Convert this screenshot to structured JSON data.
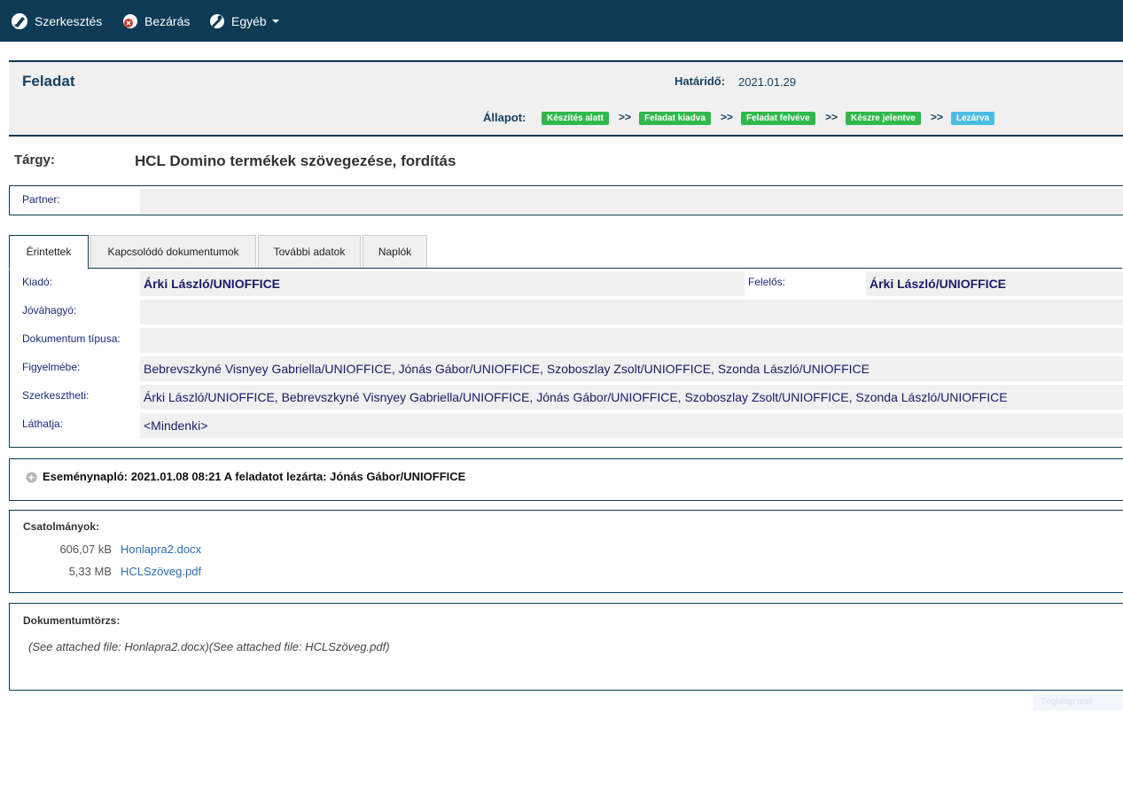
{
  "toolbar": {
    "edit_label": "Szerkesztés",
    "close_label": "Bezárás",
    "other_label": "Egyéb"
  },
  "header": {
    "title": "Feladat",
    "deadline_label": "Határidő:",
    "deadline_value": "2021.01.29",
    "status_label": "Állapot:",
    "arrow": ">>",
    "statuses": [
      {
        "label": "Készítés alatt",
        "color": "#2fb84c"
      },
      {
        "label": "Feladat kiadva",
        "color": "#2fb84c"
      },
      {
        "label": "Feladat felvéve",
        "color": "#2fb84c"
      },
      {
        "label": "Készre jelentve",
        "color": "#2fb84c"
      },
      {
        "label": "Lezárva",
        "color": "#4bbde0"
      }
    ]
  },
  "subject": {
    "label": "Tárgy:",
    "value": "HCL Domino termékek szövegezése, fordítás"
  },
  "partner": {
    "label": "Partner:",
    "value": ""
  },
  "tabs": [
    {
      "label": "Érintettek"
    },
    {
      "label": "Kapcsolódó dokumentumok"
    },
    {
      "label": "További adatok"
    },
    {
      "label": "Naplók"
    }
  ],
  "fields": {
    "kiado_label": "Kiadó:",
    "kiado_value": "Árki László/UNIOFFICE",
    "felelos_label": "Felelős:",
    "felelos_value": "Árki László/UNIOFFICE",
    "jovahagyo_label": "Jóváhagyó:",
    "jovahagyo_value": "",
    "doctype_label": "Dokumentum típusa:",
    "doctype_value": "",
    "figyelmebe_label": "Figyelmébe:",
    "figyelmebe_value": "Bebrevszkyné Visnyey Gabriella/UNIOFFICE, Jónás Gábor/UNIOFFICE, Szoboszlay Zsolt/UNIOFFICE, Szonda László/UNIOFFICE",
    "szerkesztheti_label": "Szerkesztheti:",
    "szerkesztheti_value": "Árki László/UNIOFFICE, Bebrevszkyné Visnyey Gabriella/UNIOFFICE, Jónás Gábor/UNIOFFICE, Szoboszlay Zsolt/UNIOFFICE, Szonda László/UNIOFFICE",
    "lathatja_label": "Láthatja:",
    "lathatja_value": "<Mindenki>"
  },
  "event_log": {
    "text": "Eseménynapló: 2021.01.08 08:21 A feladatot lezárta: Jónás Gábor/UNIOFFICE"
  },
  "attachments": {
    "title": "Csatolmányok:",
    "items": [
      {
        "size": "606,07 kB",
        "name": "Honlapra2.docx"
      },
      {
        "size": "5,33 MB",
        "name": "HCLSzöveg.pdf"
      }
    ]
  },
  "document_body": {
    "title": "Dokumentumtörzs:",
    "text": "(See attached file: Honlapra2.docx)(See attached file: HCLSzöveg.pdf)"
  },
  "ghost_widget": {
    "label": "Téglalap alak"
  }
}
